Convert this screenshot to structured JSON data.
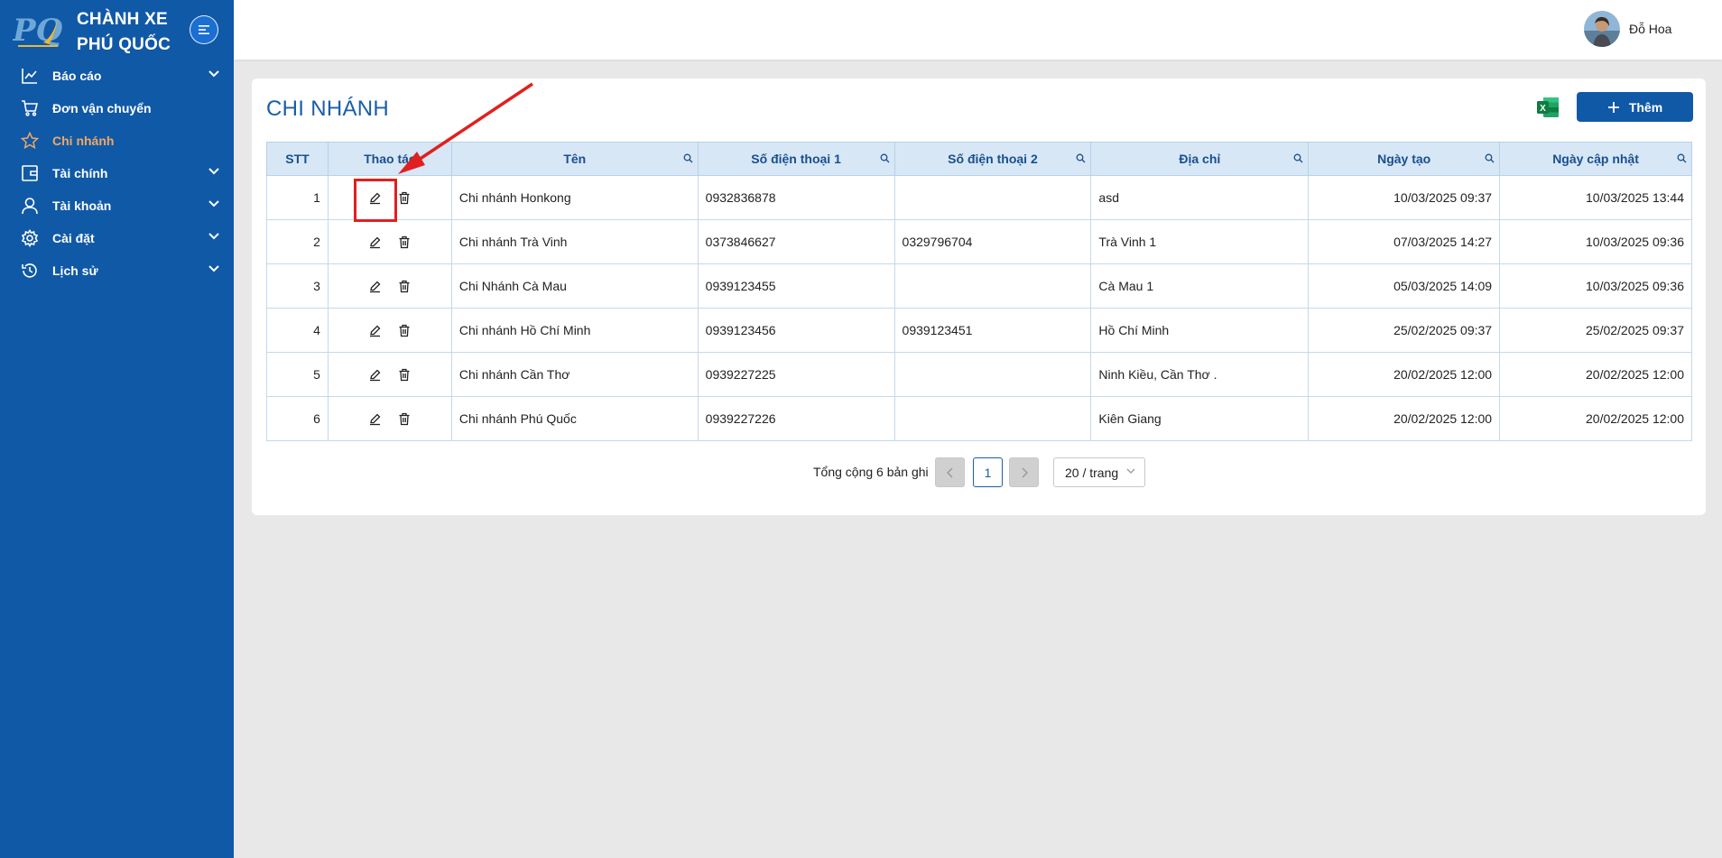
{
  "brand": {
    "line1": "CHÀNH XE",
    "line2": "PHÚ QUỐC",
    "logo_text": "PQ"
  },
  "sidebar": {
    "items": [
      {
        "label": "Báo cáo",
        "icon": "chart-line-icon",
        "has_children": true,
        "active": false
      },
      {
        "label": "Đơn vận chuyển",
        "icon": "cart-icon",
        "has_children": false,
        "active": false
      },
      {
        "label": "Chi nhánh",
        "icon": "star-icon",
        "has_children": false,
        "active": true
      },
      {
        "label": "Tài chính",
        "icon": "wallet-icon",
        "has_children": true,
        "active": false
      },
      {
        "label": "Tài khoản",
        "icon": "user-icon",
        "has_children": true,
        "active": false
      },
      {
        "label": "Cài đặt",
        "icon": "gear-icon",
        "has_children": true,
        "active": false
      },
      {
        "label": "Lịch sử",
        "icon": "history-icon",
        "has_children": true,
        "active": false
      }
    ]
  },
  "header": {
    "username": "Đỗ Hoa"
  },
  "page": {
    "title": "CHI NHÁNH",
    "add_label": "Thêm",
    "excel_text": "X"
  },
  "table": {
    "columns": [
      "STT",
      "Thao tác",
      "Tên",
      "Số điện thoại 1",
      "Số điện thoại 2",
      "Địa chỉ",
      "Ngày tạo",
      "Ngày cập nhật"
    ],
    "rows": [
      {
        "stt": "1",
        "name": "Chi nhánh Honkong",
        "phone1": "0932836878",
        "phone2": "",
        "address": "asd",
        "created": "10/03/2025 09:37",
        "updated": "10/03/2025 13:44"
      },
      {
        "stt": "2",
        "name": "Chi nhánh Trà Vinh",
        "phone1": "0373846627",
        "phone2": "0329796704",
        "address": "Trà Vinh 1",
        "created": "07/03/2025 14:27",
        "updated": "10/03/2025 09:36"
      },
      {
        "stt": "3",
        "name": "Chi Nhánh Cà Mau",
        "phone1": "0939123455",
        "phone2": "",
        "address": "Cà Mau 1",
        "created": "05/03/2025 14:09",
        "updated": "10/03/2025 09:36"
      },
      {
        "stt": "4",
        "name": "Chi nhánh Hồ Chí Minh",
        "phone1": "0939123456",
        "phone2": "0939123451",
        "address": "Hồ Chí Minh",
        "created": "25/02/2025 09:37",
        "updated": "25/02/2025 09:37"
      },
      {
        "stt": "5",
        "name": "Chi nhánh Cần Thơ",
        "phone1": "0939227225",
        "phone2": "",
        "address": "Ninh Kiều, Cần Thơ .",
        "created": "20/02/2025 12:00",
        "updated": "20/02/2025 12:00"
      },
      {
        "stt": "6",
        "name": "Chi nhánh Phú Quốc",
        "phone1": "0939227226",
        "phone2": "",
        "address": "Kiên Giang",
        "created": "20/02/2025 12:00",
        "updated": "20/02/2025 12:00"
      }
    ]
  },
  "pagination": {
    "total_text": "Tổng cộng 6 bản ghi",
    "current_page": "1",
    "prev_symbol": "<",
    "next_symbol": ">",
    "page_size": "20 / trang"
  },
  "colors": {
    "sidebar": "#1059a7",
    "active_nav": "#f0a864",
    "header_bg": "#d7e7f5",
    "title": "#1a5ea8",
    "annotation": "#e02020"
  }
}
